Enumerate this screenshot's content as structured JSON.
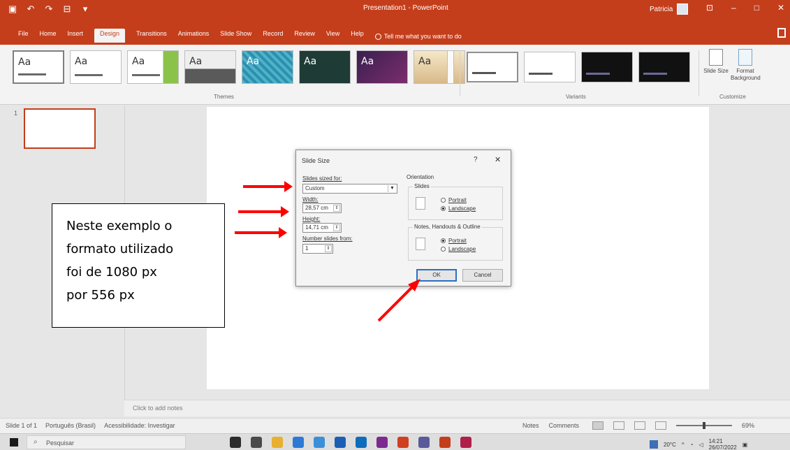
{
  "window": {
    "title": "Presentation1 - PowerPoint",
    "user": "Patricia",
    "qat_icons": [
      "save-icon",
      "undo-icon",
      "redo-icon",
      "present-icon",
      "customize-icon"
    ]
  },
  "tabs": [
    "File",
    "Home",
    "Insert",
    "Design",
    "Transitions",
    "Animations",
    "Slide Show",
    "Record",
    "Review",
    "View",
    "Help"
  ],
  "active_tab": "Design",
  "tell_me": "Tell me what you want to do",
  "ribbon": {
    "themes_label": "Themes",
    "theme_sample": "Aa",
    "variants_label": "Variants",
    "customize_label": "Customize",
    "slide_size": "Slide Size",
    "format_background": "Format Background"
  },
  "slide_pane": {
    "slide_number": "1"
  },
  "notes_placeholder": "Click to add notes",
  "status": {
    "slide": "Slide 1 of 1",
    "language": "Português (Brasil)",
    "accessibility": "Acessibilidade: Investigar",
    "notes": "Notes",
    "comments": "Comments",
    "zoom": "69%"
  },
  "dialog": {
    "title": "Slide Size",
    "help": "?",
    "close": "✕",
    "slides_sized_for_label": "Slides sized for:",
    "slides_sized_for_value": "Custom",
    "width_label": "Width:",
    "width_value": "28,57 cm",
    "height_label": "Height:",
    "height_value": "14,71 cm",
    "number_from_label": "Number slides from:",
    "number_from_value": "1",
    "orientation_label": "Orientation",
    "slides_group": "Slides",
    "slides_portrait": "Portrait",
    "slides_landscape": "Landscape",
    "notes_group": "Notes, Handouts & Outline",
    "notes_portrait": "Portrait",
    "notes_landscape": "Landscape",
    "ok": "OK",
    "cancel": "Cancel"
  },
  "annotation": {
    "lines": [
      "Neste exemplo o",
      "formato utilizado",
      "foi de 1080 px",
      "por 556 px"
    ],
    "arrow_color": "#ff0000"
  },
  "taskbar": {
    "search_placeholder": "Pesquisar",
    "weather": "20°C",
    "time": "14:21",
    "date": "26/07/2022"
  },
  "colors": {
    "accent": "#c43e1c",
    "ok_border": "#2b6fc4"
  }
}
